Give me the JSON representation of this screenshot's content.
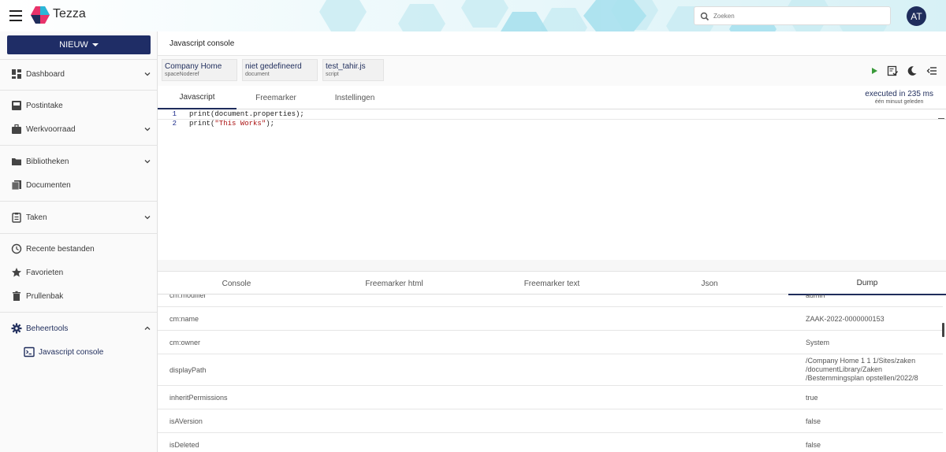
{
  "header": {
    "brand": "Tezza",
    "search_placeholder": "Zoeken",
    "avatar_initials": "AT",
    "accent_color": "#1f2d5c"
  },
  "sidebar": {
    "new_button": "NIEUW",
    "items": [
      {
        "label": "Dashboard",
        "icon": "dashboard-icon"
      },
      {
        "label": "Postintake",
        "icon": "inbox-icon"
      },
      {
        "label": "Werkvoorraad",
        "icon": "briefcase-icon"
      },
      {
        "label": "Bibliotheken",
        "icon": "folder-icon"
      },
      {
        "label": "Documenten",
        "icon": "documents-icon"
      },
      {
        "label": "Taken",
        "icon": "clipboard-icon"
      },
      {
        "label": "Recente bestanden",
        "icon": "clock-icon"
      },
      {
        "label": "Favorieten",
        "icon": "star-icon"
      },
      {
        "label": "Prullenbak",
        "icon": "trash-icon"
      },
      {
        "label": "Beheertools",
        "icon": "gear-icon"
      },
      {
        "label": "Javascript console",
        "icon": "console-icon"
      }
    ]
  },
  "main": {
    "title": "Javascript console",
    "params": [
      {
        "value": "Company Home",
        "label": "spaceNoderef"
      },
      {
        "value": "niet gedefineerd",
        "label": "document"
      },
      {
        "value": "test_tahir.js",
        "label": "script"
      }
    ],
    "tabs": [
      "Javascript",
      "Freemarker",
      "Instellingen"
    ],
    "execution": {
      "time": "executed in 235 ms",
      "ago": "één minuut geleden"
    },
    "code_lines": [
      {
        "num": "1",
        "pre": "print(document.properties);",
        "str": "",
        "post": ""
      },
      {
        "num": "2",
        "pre": "print(",
        "str": "\"This Works\"",
        "post": ");"
      }
    ],
    "result_tabs": [
      "Console",
      "Freemarker html",
      "Freemarker text",
      "Json",
      "Dump"
    ],
    "rows": [
      {
        "key": "cm:modifier",
        "value": "admin"
      },
      {
        "key": "cm:name",
        "value": "ZAAK-2022-0000000153"
      },
      {
        "key": "cm:owner",
        "value": "System"
      },
      {
        "key": "displayPath",
        "value": "/Company Home 1 1 1/Sites/zaken /documentLibrary/Zaken /Bestemmingsplan opstellen/2022/8"
      },
      {
        "key": "inheritPermissions",
        "value": "true"
      },
      {
        "key": "isAVersion",
        "value": "false"
      },
      {
        "key": "isDeleted",
        "value": "false"
      }
    ]
  }
}
